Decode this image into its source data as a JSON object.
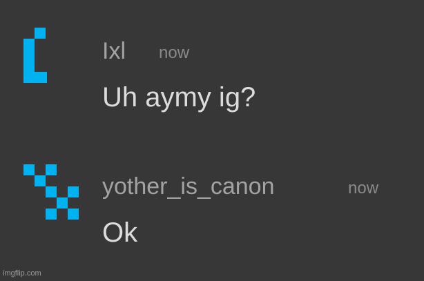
{
  "colors": {
    "background": "#373737",
    "avatar_accent": "#00b2f0",
    "username": "#a3a3a3",
    "timestamp": "#8a8a8a",
    "message_text": "#dcdcdc"
  },
  "messages": [
    {
      "username": "Ixl",
      "timestamp": "now",
      "text": "Uh aymy ig?",
      "avatar_icon": "pixel-bracket-avatar-icon"
    },
    {
      "username": "yother_is_canon",
      "timestamp": "now",
      "text": "Ok",
      "avatar_icon": "pixel-x-avatar-icon"
    }
  ],
  "watermark": {
    "text": "imgflip.com"
  }
}
